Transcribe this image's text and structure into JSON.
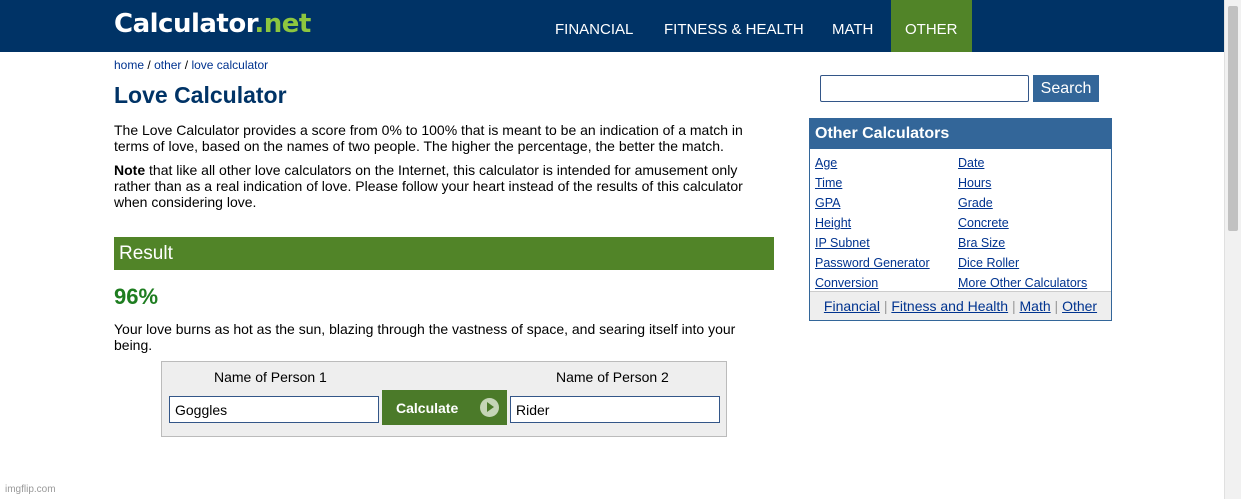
{
  "header": {
    "logo_main": "Calculator",
    "logo_dot": ".",
    "logo_net": "net",
    "nav": [
      "FINANCIAL",
      "FITNESS & HEALTH",
      "MATH",
      "OTHER"
    ]
  },
  "breadcrumb": {
    "home": "home",
    "other": "other",
    "current": "love calculator",
    "sep": "/"
  },
  "page": {
    "title": "Love Calculator",
    "intro": "The Love Calculator provides a score from 0% to 100% that is meant to be an indication of a match in terms of love, based on the names of two people. The higher the percentage, the better the match.",
    "note_label": "Note",
    "note_text": " that like all other love calculators on the Internet, this calculator is intended for amusement only rather than as a real indication of love. Please follow your heart instead of the results of this calculator when considering love."
  },
  "result": {
    "heading": "Result",
    "percent": "96%",
    "message": "Your love burns as hot as the sun, blazing through the vastness of space, and searing itself into your being."
  },
  "form": {
    "person1_label": "Name of Person 1",
    "person2_label": "Name of Person 2",
    "person1_value": "Goggles",
    "person2_value": "Rider",
    "calculate_label": "Calculate"
  },
  "search": {
    "button_label": "Search",
    "value": ""
  },
  "other_calculators": {
    "heading": "Other Calculators",
    "left": [
      "Age",
      "Time",
      "GPA",
      "Height",
      "IP Subnet",
      "Password Generator",
      "Conversion"
    ],
    "right": [
      "Date",
      "Hours",
      "Grade",
      "Concrete",
      "Bra Size",
      "Dice Roller",
      "More Other Calculators"
    ],
    "footer": [
      "Financial",
      "Fitness and Health",
      "Math",
      "Other"
    ],
    "footer_sep": "|"
  },
  "watermark": "imgflip.com",
  "colors": {
    "header_bg": "#003366",
    "accent_green": "#518428",
    "result_green": "#1e7d20",
    "box_blue": "#336699"
  }
}
